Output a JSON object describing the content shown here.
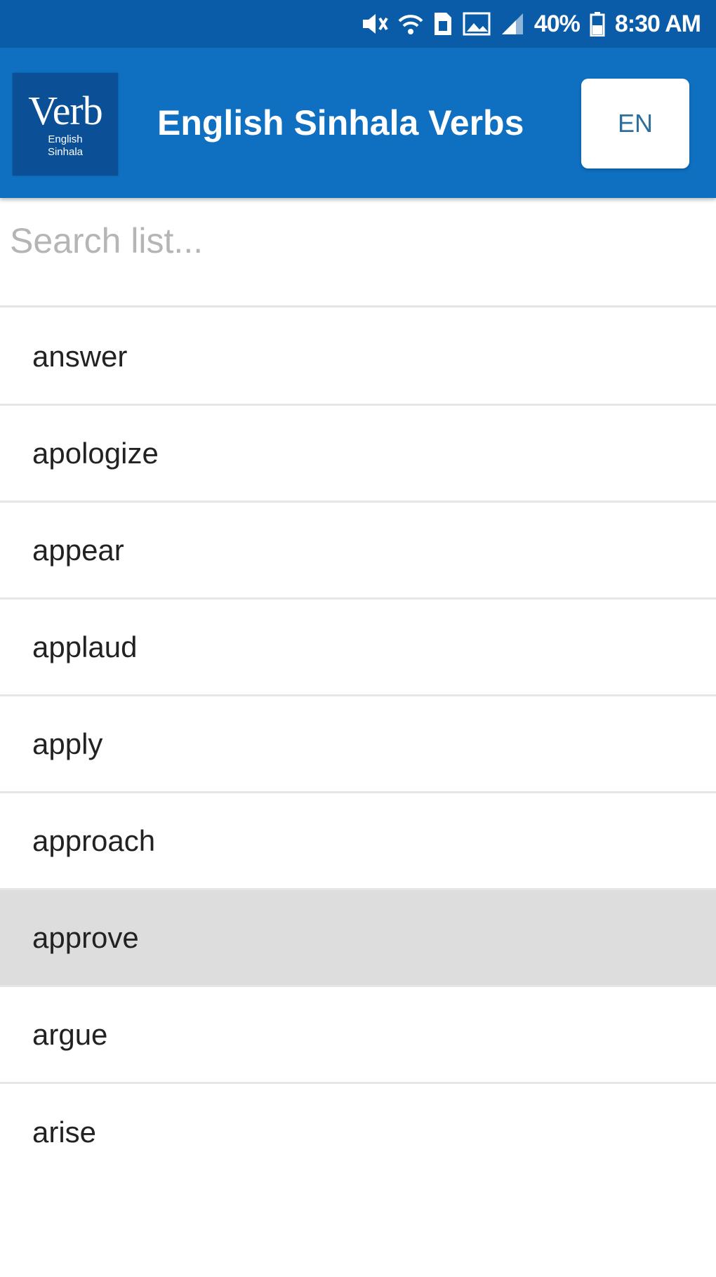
{
  "status_bar": {
    "battery": "40%",
    "time": "8:30 AM",
    "icons": [
      "mute-icon",
      "wifi-icon",
      "sim-icon",
      "image-icon",
      "signal-icon",
      "battery-icon"
    ]
  },
  "app_bar": {
    "logo_word": "Verb",
    "logo_sub_1": "English",
    "logo_sub_2": "Sinhala",
    "title": "English Sinhala Verbs",
    "lang_button": "EN"
  },
  "search": {
    "placeholder": "Search list...",
    "value": ""
  },
  "verbs": [
    {
      "label": "answer"
    },
    {
      "label": "apologize"
    },
    {
      "label": "appear"
    },
    {
      "label": "applaud"
    },
    {
      "label": "apply"
    },
    {
      "label": "approach"
    },
    {
      "label": "approve",
      "selected": true
    },
    {
      "label": "argue"
    },
    {
      "label": "arise"
    }
  ],
  "colors": {
    "status_bar": "#0b5ca8",
    "app_bar": "#0f6fc0",
    "selected_row": "#dddddd"
  }
}
